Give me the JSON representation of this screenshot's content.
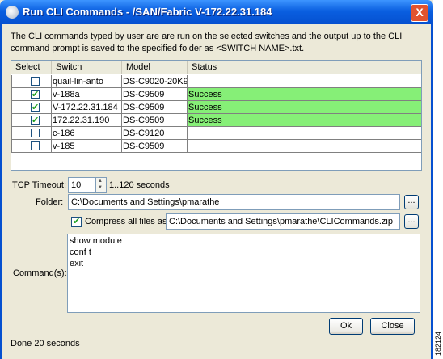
{
  "window": {
    "title": "Run CLI Commands - /SAN/Fabric V-172.22.31.184",
    "close_label": "X"
  },
  "description": "The CLI commands typed by user are are run on the selected switches and the output up to the CLI command prompt is saved to the specified folder as <SWITCH NAME>.txt.",
  "table": {
    "headers": [
      "Select",
      "Switch",
      "Model",
      "Status"
    ],
    "rows": [
      {
        "checked": false,
        "switch": "quail-lin-anto",
        "model": "DS-C9020-20K9",
        "status": ""
      },
      {
        "checked": true,
        "switch": "v-188a",
        "model": "DS-C9509",
        "status": "Success"
      },
      {
        "checked": true,
        "switch": "V-172.22.31.184",
        "model": "DS-C9509",
        "status": "Success"
      },
      {
        "checked": true,
        "switch": "172.22.31.190",
        "model": "DS-C9509",
        "status": "Success"
      },
      {
        "checked": false,
        "switch": "c-186",
        "model": "DS-C9120",
        "status": ""
      },
      {
        "checked": false,
        "switch": "v-185",
        "model": "DS-C9509",
        "status": ""
      }
    ],
    "success_color": "#86ef77"
  },
  "tcp_timeout": {
    "label": "TCP Timeout:",
    "value": "10",
    "range": "1..120 seconds"
  },
  "folder": {
    "label": "Folder:",
    "value": "C:\\Documents and Settings\\pmarathe",
    "browse_label": "..."
  },
  "compress": {
    "checked": true,
    "label": "Compress all files as",
    "value": "C:\\Documents and Settings\\pmarathe\\CLICommands.zip",
    "browse_label": "..."
  },
  "commands": {
    "label": "Command(s):",
    "lines": [
      "show module",
      "conf t",
      "exit"
    ]
  },
  "buttons": {
    "ok": "Ok",
    "close": "Close"
  },
  "status_text": "Done 20 seconds",
  "figure_code": "182124"
}
